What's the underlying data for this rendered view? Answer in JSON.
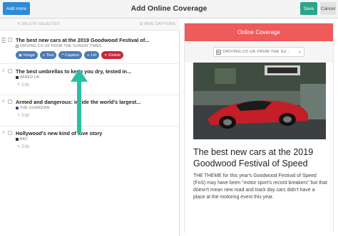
{
  "header": {
    "add_more": "Add more",
    "title": "Add Online Coverage",
    "save": "Save",
    "cancel": "Cancel"
  },
  "toolbar": {
    "delete_selected": "DELETE SELECTED",
    "hide_captions": "HIDE CAPTIONS"
  },
  "items": [
    {
      "title": "The best new cars at the 2019 Goodwood Festival of...",
      "source": "DRIVING.CO.UK FROM THE SUNDAY TIMES",
      "actions": [
        "Image",
        "Text",
        "Caption",
        "Url",
        "Delete"
      ]
    },
    {
      "number": "2",
      "title": "The best umbrellas to keep you dry, tested in...",
      "source": "WIRED UK",
      "edit": "Edit"
    },
    {
      "number": "3",
      "title": "Armed and dangerous: inside the world's largest...",
      "source": "THE GUARDIAN",
      "edit": "Edit"
    },
    {
      "number": "4",
      "title": "Hollywood's new kind of love story",
      "source": "BBC",
      "edit": "Edit"
    }
  ],
  "preview": {
    "header": "Online Coverage",
    "url": "DRIVING.CO.UK FROM THE SU...",
    "title": "The best new cars at the 2019 Goodwood Festival of Speed",
    "body": "THE THEME for this year's Goodwood Festival of Speed (FoS) may have been \"motor sport's record breakers\" but that doesn't mean new road and track day cars didn't have a place at the motoring event this year."
  },
  "colors": {
    "primary": "#2e8bd6",
    "save": "#2aa58a",
    "accent": "#ef5a5b",
    "pill": "#4d7bb5",
    "delete": "#c6283f",
    "arrow": "#29bfa6"
  }
}
